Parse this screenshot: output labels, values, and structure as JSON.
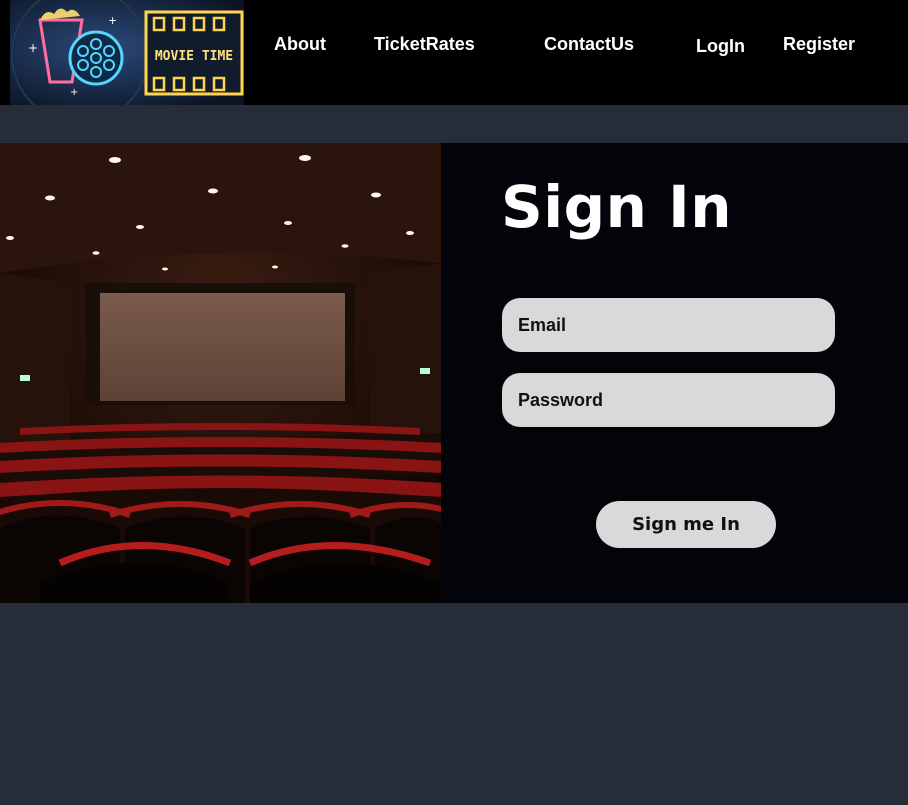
{
  "logo": {
    "text": "MOVIE TIME",
    "icon": "popcorn-film-reel-logo"
  },
  "nav": {
    "about": "About",
    "ticket_rates": "TicketRates",
    "contact": "ContactUs",
    "login": "LogIn",
    "register": "Register"
  },
  "hero": {
    "image": "cinema-auditorium-photo"
  },
  "signin": {
    "title": "Sign In",
    "email_placeholder": "Email",
    "password_placeholder": "Password",
    "submit_label": "Sign me In"
  },
  "colors": {
    "page_bg": "#272d38",
    "nav_bg": "#000000",
    "panel_bg": "#02040a",
    "field_bg": "#d9d9d9",
    "text_light": "#ffffff"
  }
}
